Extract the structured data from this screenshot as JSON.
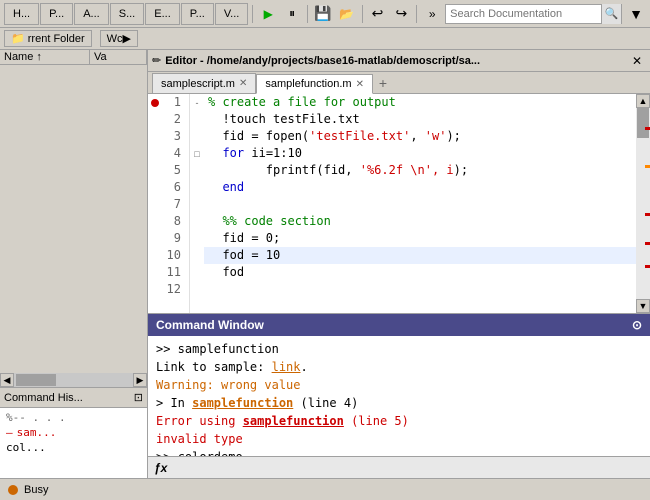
{
  "toolbar": {
    "tabs": [
      "H...",
      "P...",
      "A...",
      "S...",
      "E...",
      "P...",
      "V..."
    ],
    "search_placeholder": "Search Documentation",
    "run_icon": "▶",
    "filter_icon": "▼"
  },
  "breadcrumb": {
    "label": "rrent Folder",
    "workspace_label": "Wc▶"
  },
  "editor": {
    "title": "Editor - /home/andy/projects/base16-matlab/demoscript/sa...",
    "close": "✕",
    "tabs": [
      {
        "label": "samplescript.m",
        "active": false
      },
      {
        "label": "samplefunction.m",
        "active": true
      }
    ],
    "add_tab": "+",
    "lines": [
      {
        "num": 1,
        "indent": "  ",
        "content": "% create a file for output",
        "type": "comment",
        "bp": true
      },
      {
        "num": 2,
        "indent": "  ",
        "content": "!touch testFile.txt",
        "type": "shell"
      },
      {
        "num": 3,
        "indent": "  ",
        "content": "fid = fopen('testFile.txt', 'w');",
        "type": "code"
      },
      {
        "num": 4,
        "indent": "  ",
        "content": "for ii=1:10",
        "type": "code",
        "fold": true
      },
      {
        "num": 5,
        "indent": "      ",
        "content": "fprintf(fid, '%6.2f \\n', i);",
        "type": "code"
      },
      {
        "num": 6,
        "indent": "  ",
        "content": "end",
        "type": "code"
      },
      {
        "num": 7,
        "indent": "",
        "content": "",
        "type": "empty"
      },
      {
        "num": 8,
        "indent": "  ",
        "content": "%% code section",
        "type": "section"
      },
      {
        "num": 9,
        "indent": "  ",
        "content": "fid = 0;",
        "type": "code",
        "highlighted": false
      },
      {
        "num": 10,
        "indent": "  ",
        "content": "fod = 10",
        "type": "code",
        "highlighted": true
      },
      {
        "num": 11,
        "indent": "  ",
        "content": "fod",
        "type": "code"
      },
      {
        "num": 12,
        "indent": "",
        "content": "",
        "type": "empty"
      }
    ]
  },
  "left_panel": {
    "title": "rrent Folder",
    "workspace": "Wc▶",
    "columns": [
      "Name ↑",
      "Va"
    ],
    "files": []
  },
  "cmd_history": {
    "title": "Command His...",
    "items": [
      {
        "text": "%-- . . .",
        "type": "separator"
      },
      {
        "text": "sam...",
        "type": "error"
      },
      {
        "text": "col...",
        "type": "normal"
      }
    ]
  },
  "command_window": {
    "title": "Command Window",
    "collapse_icon": "⊙",
    "lines": [
      {
        "type": "prompt",
        "text": ">> samplefunction"
      },
      {
        "type": "info",
        "prefix": "Link to sample: ",
        "link": "link",
        "suffix": "."
      },
      {
        "type": "warning",
        "text": "Warning: wrong value"
      },
      {
        "type": "info2",
        "text": "In ",
        "func": "samplefunction",
        "rest": " (line 4)"
      },
      {
        "type": "error",
        "prefix": "Error using ",
        "func": "samplefunction",
        "rest": " (line 5)"
      },
      {
        "type": "error_msg",
        "text": "invalid type"
      },
      {
        "type": "prompt",
        "text": ">> colordemo"
      }
    ],
    "input_fx": "ƒx"
  },
  "status_bar": {
    "status": "Busy"
  },
  "markers": [
    {
      "pos": 15,
      "color": "red"
    },
    {
      "pos": 30,
      "color": "orange"
    },
    {
      "pos": 55,
      "color": "red"
    },
    {
      "pos": 70,
      "color": "red"
    },
    {
      "pos": 80,
      "color": "red"
    }
  ]
}
